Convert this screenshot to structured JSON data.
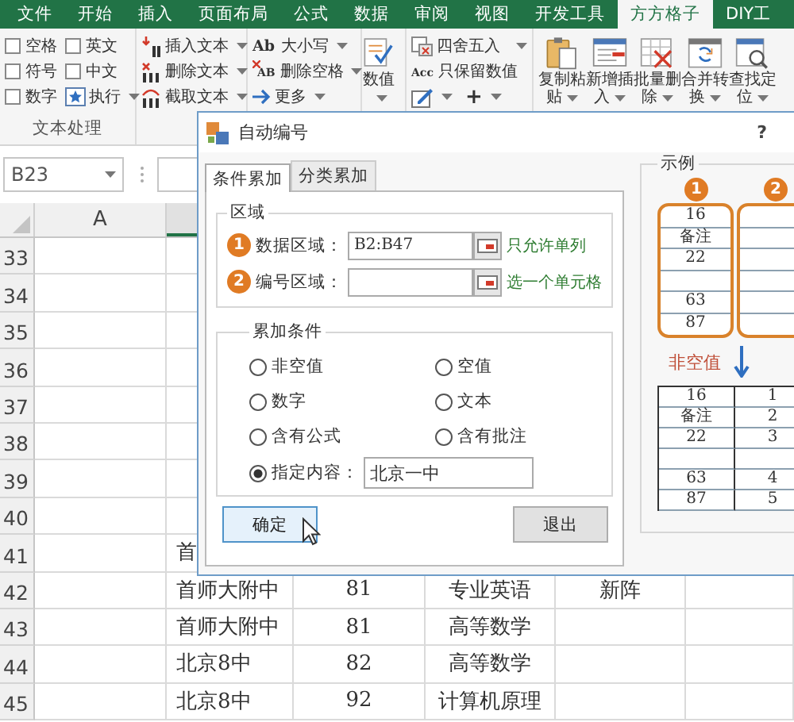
{
  "ribbon": {
    "tabs": [
      {
        "label": "文件",
        "selected": false
      },
      {
        "label": "开始",
        "selected": false
      },
      {
        "label": "插入",
        "selected": false
      },
      {
        "label": "页面布局",
        "selected": false
      },
      {
        "label": "公式",
        "selected": false
      },
      {
        "label": "数据",
        "selected": false
      },
      {
        "label": "审阅",
        "selected": false
      },
      {
        "label": "视图",
        "selected": false
      },
      {
        "label": "开发工具",
        "selected": false
      },
      {
        "label": "方方格子",
        "selected": true
      },
      {
        "label": "DIY工",
        "selected": false
      }
    ],
    "text_group": {
      "options": [
        {
          "label": "空格",
          "checked": false
        },
        {
          "label": "英文",
          "checked": false
        },
        {
          "label": "符号",
          "checked": false
        },
        {
          "label": "中文",
          "checked": false
        },
        {
          "label": "数字",
          "checked": false
        }
      ],
      "run_button": "执行",
      "group_label": "文本处理"
    },
    "text_tools": [
      {
        "label": "插入文本",
        "kind": "insert"
      },
      {
        "label": "删除文本",
        "kind": "delete"
      },
      {
        "label": "截取文本",
        "kind": "extract"
      }
    ],
    "case_tools": [
      {
        "icon": "Ab",
        "label": "大小写",
        "kind": "case"
      },
      {
        "icon": "AB",
        "label": "删除空格",
        "kind": "trim"
      },
      {
        "label": "更多",
        "kind": "more"
      }
    ],
    "number_button": "数值",
    "round_tools": [
      {
        "label": "四舍五入",
        "kind": "round",
        "dropdown": true
      },
      {
        "icon": "Acc",
        "label": "只保留数值",
        "kind": "keep",
        "dropdown": false
      }
    ],
    "plus_button": "+",
    "big_buttons": [
      {
        "label": "复制粘贴",
        "kind": "paste"
      },
      {
        "label": "新增插入",
        "kind": "insert"
      },
      {
        "label": "批量删除",
        "kind": "delete"
      },
      {
        "label": "合并转换",
        "kind": "merge"
      },
      {
        "label": "查找定位",
        "kind": "find"
      }
    ]
  },
  "name_box": "B23",
  "sheet": {
    "column_header": "A",
    "rows": [
      {
        "number": "33"
      },
      {
        "number": "34"
      },
      {
        "number": "35"
      },
      {
        "number": "36"
      },
      {
        "number": "37"
      },
      {
        "number": "38"
      },
      {
        "number": "39"
      },
      {
        "number": "40"
      },
      {
        "number": "41",
        "cells": [
          null,
          "首"
        ]
      },
      {
        "number": "42",
        "cells": [
          null,
          "首师大附中",
          "81",
          "专业英语",
          "新阵"
        ]
      },
      {
        "number": "43",
        "cells": [
          null,
          "首师大附中",
          "81",
          "高等数学"
        ]
      },
      {
        "number": "44",
        "cells": [
          null,
          "北京8中",
          "82",
          "高等数学"
        ]
      },
      {
        "number": "45",
        "cells": [
          null,
          "北京8中",
          "92",
          "计算机原理"
        ]
      }
    ]
  },
  "dialog": {
    "title": "自动编号",
    "help": "?",
    "tabs": [
      {
        "label": "条件累加",
        "selected": true
      },
      {
        "label": "分类累加",
        "selected": false
      }
    ],
    "area_group": {
      "title": "区域",
      "fields": [
        {
          "badge": "1",
          "label": "数据区域：",
          "value": "B2:B47",
          "hint": "只允许单列"
        },
        {
          "badge": "2",
          "label": "编号区域：",
          "hint": "选一个单元格"
        }
      ]
    },
    "condition_group": {
      "title": "累加条件",
      "options": [
        {
          "label": "非空值",
          "selected": false
        },
        {
          "label": "空值",
          "selected": false
        },
        {
          "label": "数字",
          "selected": false
        },
        {
          "label": "文本",
          "selected": false
        },
        {
          "label": "含有公式",
          "selected": false
        },
        {
          "label": "含有批注",
          "selected": false
        },
        {
          "label": "指定内容：",
          "selected": true,
          "value": "北京一中"
        }
      ]
    },
    "buttons": [
      {
        "label": "确定",
        "focused": true
      },
      {
        "label": "退出",
        "focused": false
      }
    ],
    "example": {
      "title": "示例",
      "badges": [
        "1",
        "2"
      ],
      "before_rows": [
        "16",
        "备注",
        "22",
        null,
        "63",
        "87"
      ],
      "condition": "非空值",
      "after_rows": [
        {
          "value": "16",
          "number": "1"
        },
        {
          "value": "备注",
          "number": "2"
        },
        {
          "value": "22",
          "number": "3"
        },
        null,
        {
          "value": "63",
          "number": "4"
        },
        {
          "value": "87",
          "number": "5"
        }
      ]
    }
  }
}
